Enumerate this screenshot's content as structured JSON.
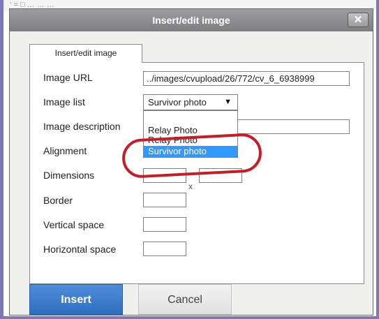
{
  "background": {
    "strip_text": "‘ = □ … … …"
  },
  "dialog": {
    "title": "Insert/edit image",
    "close_label": "✕",
    "tab_label": "Insert/edit image",
    "fields": {
      "image_url": {
        "label": "Image URL",
        "value": "../images/cvupload/26/772/cv_6_6938999"
      },
      "image_list": {
        "label": "Image list",
        "selected": "Survivor photo",
        "options": [
          "Relay Photo",
          "Relay Photo",
          "Survivor photo"
        ],
        "highlighted_option": "Survivor photo"
      },
      "image_description": {
        "label": "Image description",
        "value": ""
      },
      "alignment": {
        "label": "Alignment"
      },
      "dimensions": {
        "label": "Dimensions",
        "width": "",
        "height": "",
        "separator": "x"
      },
      "border": {
        "label": "Border",
        "value": ""
      },
      "vertical_space": {
        "label": "Vertical space",
        "value": ""
      },
      "horizontal_space": {
        "label": "Horizontal space",
        "value": ""
      }
    },
    "buttons": {
      "insert": "Insert",
      "cancel": "Cancel"
    }
  },
  "colors": {
    "titlebar": "#8e8e90",
    "insert_button": "#3d7fcf",
    "selected_option": "#3399ff",
    "highlight_ring": "#c0202a"
  }
}
